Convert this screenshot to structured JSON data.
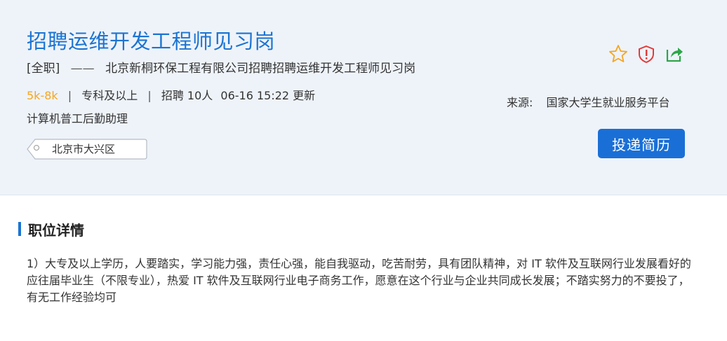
{
  "job": {
    "title": "招聘运维开发工程师见习岗",
    "type": "[全职]",
    "dash": "——",
    "company_line": "北京新桐环保工程有限公司招聘招聘运维开发工程师见习岗",
    "salary": "5k-8k",
    "education": "专科及以上",
    "headcount": "招聘 10人",
    "updated": "06-16 15:22 更新",
    "separator": "|",
    "skills": "计算机普工后勤助理",
    "location": "北京市大兴区"
  },
  "actions": {
    "favorite_icon": "star-icon",
    "report_icon": "shield-alert-icon",
    "share_icon": "share-icon",
    "apply_label": "投递简历"
  },
  "source": {
    "label": "来源:",
    "value": "国家大学生就业服务平台"
  },
  "details": {
    "section_title": "职位详情",
    "text": "1）大专及以上学历，人要踏实，学习能力强，责任心强，能自我驱动，吃苦耐劳，具有团队精神，对 IT 软件及互联网行业发展看好的应往届毕业生（不限专业），热爱 IT 软件及互联网行业电子商务工作，愿意在这个行业与企业共同成长发展；不踏实努力的不要投了，有无工作经验均可"
  },
  "colors": {
    "accent": "#1c74d2",
    "salary": "#f5a623",
    "star": "#f5a623",
    "report": "#e23b3b",
    "share": "#2ea64a",
    "button": "#1a6fd6"
  }
}
